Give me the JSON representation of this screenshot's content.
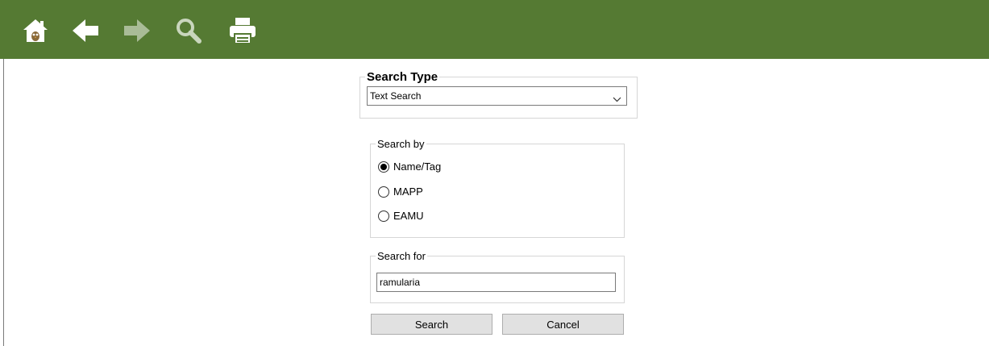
{
  "toolbar": {
    "bg_color": "#557a33",
    "buttons": [
      {
        "name": "home",
        "icon": "home-icon"
      },
      {
        "name": "back",
        "icon": "arrow-left-icon"
      },
      {
        "name": "forward",
        "icon": "arrow-right-icon",
        "disabled": true
      },
      {
        "name": "search",
        "icon": "search-icon",
        "disabled": true
      },
      {
        "name": "print",
        "icon": "printer-icon"
      }
    ]
  },
  "search_type": {
    "legend": "Search Type",
    "selected": "Text Search"
  },
  "search_by": {
    "legend": "Search by",
    "options": [
      {
        "label": "Name/Tag",
        "checked": true
      },
      {
        "label": "MAPP",
        "checked": false
      },
      {
        "label": "EAMU",
        "checked": false
      }
    ]
  },
  "search_for": {
    "legend": "Search for",
    "value": "ramularia"
  },
  "buttons": {
    "search_label": "Search",
    "cancel_label": "Cancel"
  }
}
